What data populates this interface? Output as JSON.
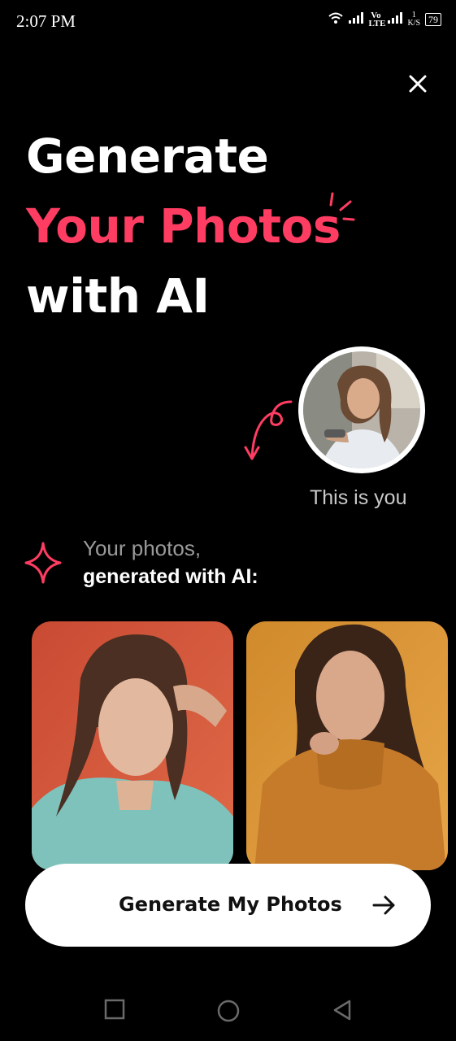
{
  "status_bar": {
    "time": "2:07 PM",
    "network_label": "Vo LTE",
    "speed_value": "1",
    "speed_unit": "K/S",
    "battery": "79"
  },
  "headline": {
    "line1": "Generate",
    "line2": "Your Photos",
    "line3": "with AI"
  },
  "avatar_caption": "This is you",
  "photos_intro": {
    "line1": "Your photos,",
    "line2": "generated with AI:"
  },
  "cta": {
    "label": "Generate My Photos"
  },
  "colors": {
    "background": "#000000",
    "accent": "#ff3d63",
    "button": "#ffffff"
  },
  "icons": [
    "close-icon",
    "sparkle-lines-icon",
    "curly-arrow-icon",
    "four-point-star-icon",
    "arrow-right-icon",
    "nav-recent-icon",
    "nav-home-icon",
    "nav-back-icon"
  ]
}
